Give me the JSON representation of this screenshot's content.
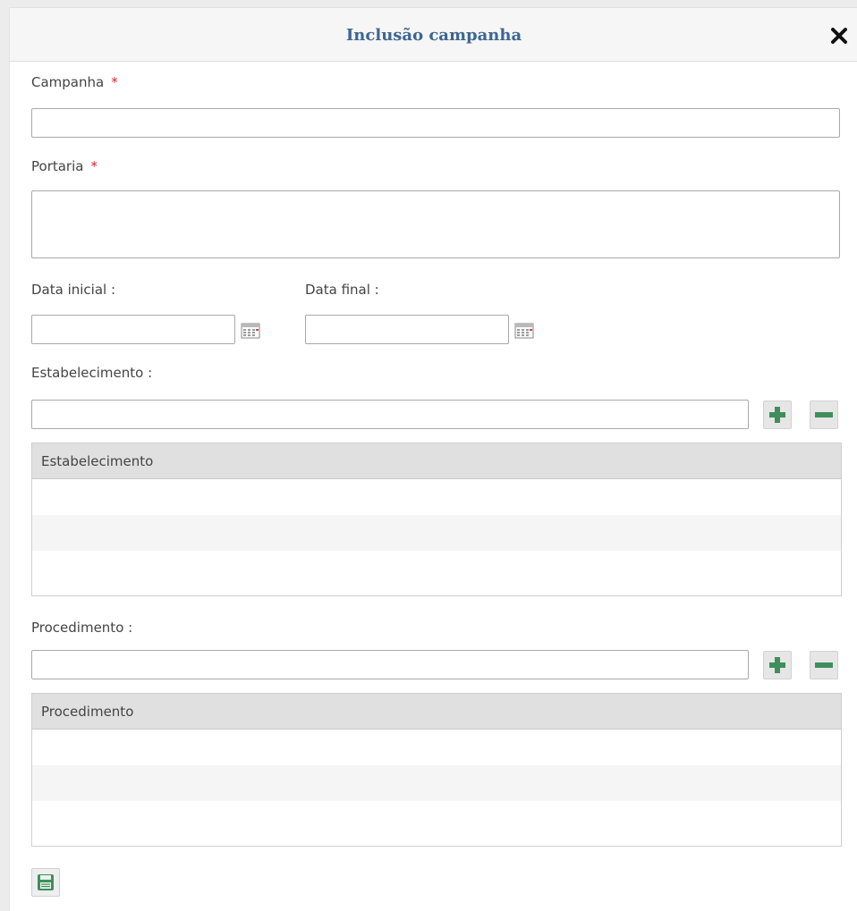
{
  "dialog": {
    "title": "Inclusão campanha",
    "close_icon": "close-icon"
  },
  "form": {
    "campanha": {
      "label": "Campanha",
      "required_mark": "*",
      "value": ""
    },
    "portaria": {
      "label": "Portaria",
      "required_mark": "*",
      "value": ""
    },
    "data_inicial": {
      "label": "Data inicial :",
      "value": "",
      "icon": "calendar-icon"
    },
    "data_final": {
      "label": "Data final :",
      "value": "",
      "icon": "calendar-icon"
    },
    "estabelecimento": {
      "label": "Estabelecimento :",
      "value": "",
      "add_icon": "plus-icon",
      "remove_icon": "minus-icon",
      "grid_header": "Estabelecimento",
      "rows": [
        "",
        "",
        ""
      ]
    },
    "procedimento": {
      "label": "Procedimento :",
      "value": "",
      "add_icon": "plus-icon",
      "remove_icon": "minus-icon",
      "grid_header": "Procedimento",
      "rows": [
        "",
        "",
        ""
      ]
    }
  },
  "footer": {
    "save_icon": "save-icon"
  },
  "colors": {
    "title": "#3d6693",
    "required": "#d9232d",
    "action_green": "#3f8f5a"
  }
}
